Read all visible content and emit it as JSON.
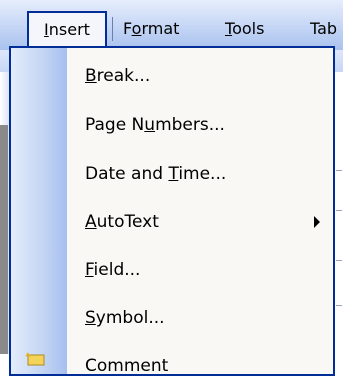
{
  "menubar": {
    "items": [
      {
        "label": "Insert",
        "mnemonic": "I",
        "rest": "nsert"
      },
      {
        "label": "Format",
        "pre": "F",
        "mnemonic": "o",
        "rest": "rmat"
      },
      {
        "label": "Tools",
        "mnemonic": "T",
        "rest": "ools"
      },
      {
        "label": "Tab",
        "pre": "",
        "mnemonic": "",
        "rest": "Tab"
      }
    ]
  },
  "insert_menu": {
    "items": [
      {
        "pre": "",
        "mnemonic": "B",
        "rest": "reak...",
        "has_submenu": false
      },
      {
        "pre": "Page N",
        "mnemonic": "u",
        "rest": "mbers...",
        "has_submenu": false
      },
      {
        "pre": "Date and ",
        "mnemonic": "T",
        "rest": "ime...",
        "has_submenu": false
      },
      {
        "pre": "",
        "mnemonic": "A",
        "rest": "utoText",
        "has_submenu": true
      },
      {
        "pre": "",
        "mnemonic": "F",
        "rest": "ield...",
        "has_submenu": false
      },
      {
        "pre": "",
        "mnemonic": "S",
        "rest": "ymbol...",
        "has_submenu": false
      },
      {
        "pre": "Co",
        "mnemonic": "",
        "rest": "mment",
        "has_submenu": false
      }
    ]
  },
  "colors": {
    "menu_border": "#002d96",
    "icon_strip": "#c2d4f3",
    "menu_background": "#f9f8f5"
  },
  "icons": {
    "comment": "comment-icon"
  }
}
